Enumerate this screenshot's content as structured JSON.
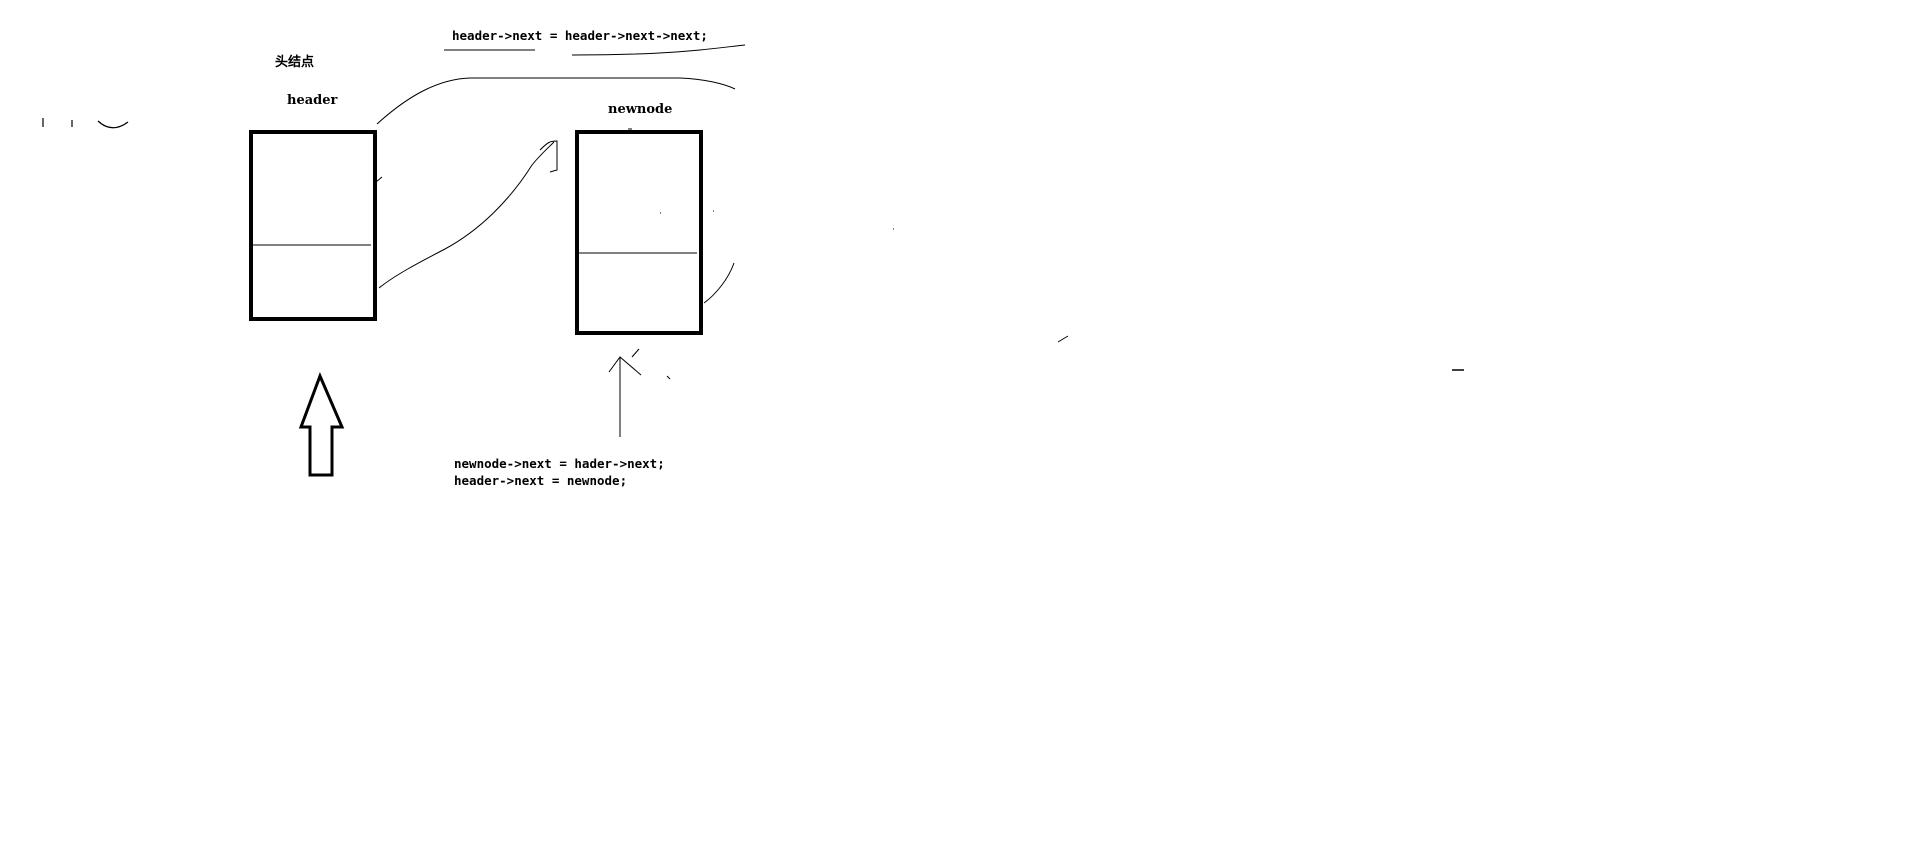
{
  "labels": {
    "head_node_cn": "头结点",
    "header": "header",
    "newnode": "newnode"
  },
  "code": {
    "top_line": "header->next = header->next->next;",
    "bottom_line_1": "newnode->next = hader->next;",
    "bottom_line_2": "header->next = newnode;"
  },
  "colors": {
    "ink": "#000000",
    "background": "#ffffff"
  }
}
